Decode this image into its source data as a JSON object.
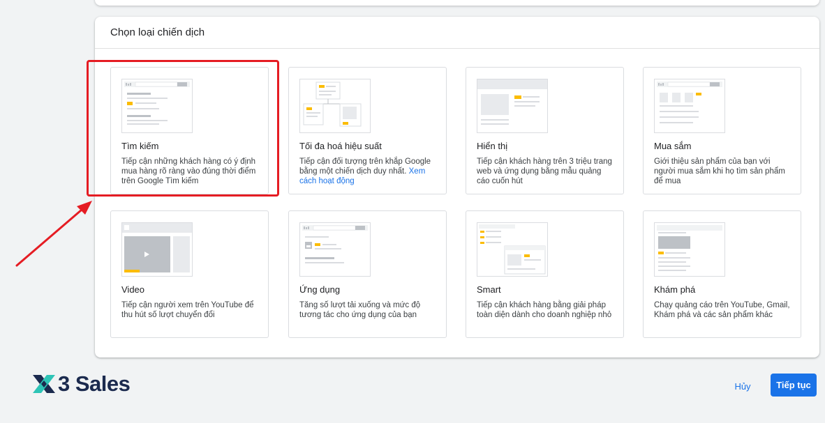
{
  "panel": {
    "title": "Chọn loại chiến dịch"
  },
  "campaign_types": [
    {
      "title": "Tìm kiếm",
      "desc": "Tiếp cận những khách hàng có ý định mua hàng rõ ràng vào đúng thời điểm trên Google Tìm kiếm",
      "icon": "search-ads-illustration"
    },
    {
      "title": "Tối đa hoá hiệu suất",
      "desc": "Tiếp cận đối tượng trên khắp Google bằng một chiến dịch duy nhất.",
      "link": "Xem cách hoạt động",
      "icon": "performance-max-illustration"
    },
    {
      "title": "Hiển thị",
      "desc": "Tiếp cận khách hàng trên 3 triệu trang web và ứng dụng bằng mẫu quảng cáo cuốn hút",
      "icon": "display-ads-illustration"
    },
    {
      "title": "Mua sắm",
      "desc": "Giới thiệu sản phẩm của bạn với người mua sắm khi họ tìm sản phẩm để mua",
      "icon": "shopping-ads-illustration"
    },
    {
      "title": "Video",
      "desc": "Tiếp cận người xem trên YouTube để thu hút số lượt chuyển đổi",
      "icon": "video-ads-illustration"
    },
    {
      "title": "Ứng dụng",
      "desc": "Tăng số lượt tải xuống và mức độ tương tác cho ứng dụng của bạn",
      "icon": "app-ads-illustration"
    },
    {
      "title": "Smart",
      "desc": "Tiếp cận khách hàng bằng giải pháp toàn diện dành cho doanh nghiệp nhỏ",
      "icon": "smart-ads-illustration"
    },
    {
      "title": "Khám phá",
      "desc": "Chạy quảng cáo trên YouTube, Gmail, Khám phá và các sản phẩm khác",
      "icon": "discovery-ads-illustration"
    }
  ],
  "footer": {
    "logo_text": "3 Sales",
    "cancel_label": "Hủy",
    "continue_label": "Tiếp tục"
  },
  "colors": {
    "accent_blue": "#1a73e8",
    "highlight_red": "#e51c23",
    "illustration_yellow": "#fbbc04",
    "logo_navy": "#1b2a4e"
  }
}
